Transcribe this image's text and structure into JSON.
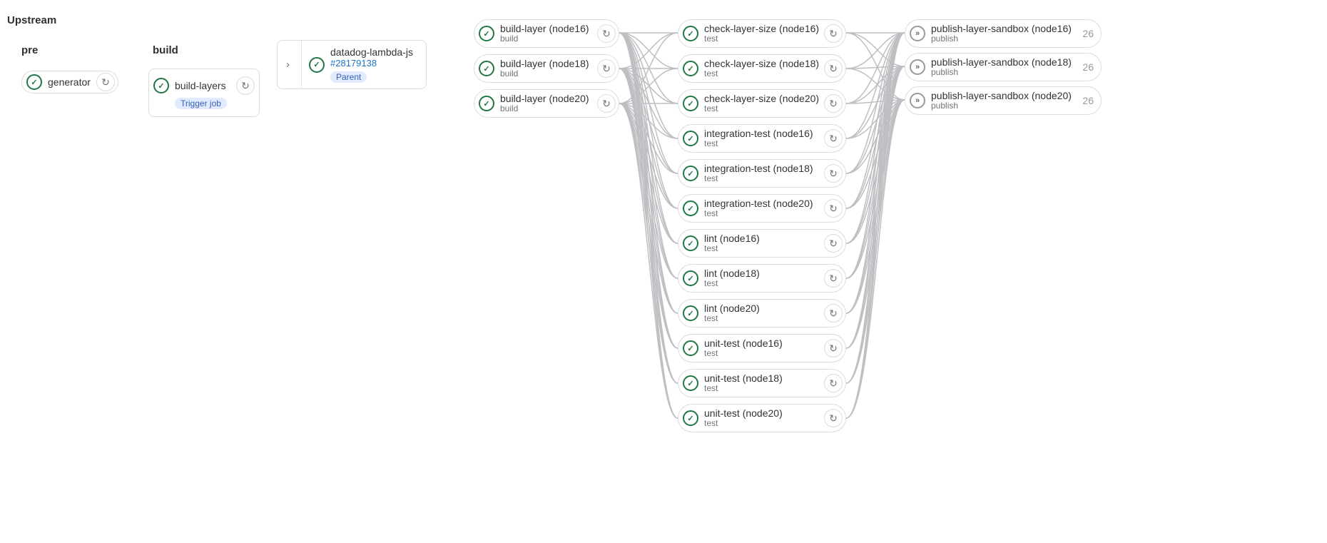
{
  "upstream_label": "Upstream",
  "stages": {
    "pre": "pre",
    "build": "build"
  },
  "jobs": {
    "generator": "generator",
    "build_layers": "build-layers",
    "trigger_tag": "Trigger job"
  },
  "parent_card": {
    "title": "datadog-lambda-js",
    "link": "#28179138",
    "badge": "Parent"
  },
  "col_build": [
    {
      "name": "build-layer (node16)",
      "stage": "build"
    },
    {
      "name": "build-layer (node18)",
      "stage": "build"
    },
    {
      "name": "build-layer (node20)",
      "stage": "build"
    }
  ],
  "col_test": [
    {
      "name": "check-layer-size (node16)",
      "stage": "test"
    },
    {
      "name": "check-layer-size (node18)",
      "stage": "test"
    },
    {
      "name": "check-layer-size (node20)",
      "stage": "test"
    },
    {
      "name": "integration-test (node16)",
      "stage": "test"
    },
    {
      "name": "integration-test (node18)",
      "stage": "test"
    },
    {
      "name": "integration-test (node20)",
      "stage": "test"
    },
    {
      "name": "lint (node16)",
      "stage": "test"
    },
    {
      "name": "lint (node18)",
      "stage": "test"
    },
    {
      "name": "lint (node20)",
      "stage": "test"
    },
    {
      "name": "unit-test (node16)",
      "stage": "test"
    },
    {
      "name": "unit-test (node18)",
      "stage": "test"
    },
    {
      "name": "unit-test (node20)",
      "stage": "test"
    }
  ],
  "col_publish": [
    {
      "name": "publish-layer-sandbox (node16)",
      "stage": "publish",
      "count": "26"
    },
    {
      "name": "publish-layer-sandbox (node18)",
      "stage": "publish",
      "count": "26"
    },
    {
      "name": "publish-layer-sandbox (node20)",
      "stage": "publish",
      "count": "26"
    }
  ]
}
